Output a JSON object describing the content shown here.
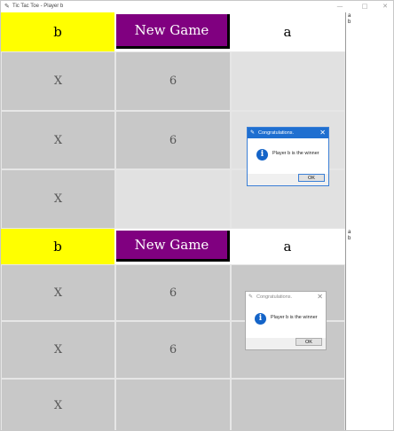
{
  "window": {
    "title": "Tic Tac Toe - Player b",
    "minimize_glyph": "—",
    "maximize_glyph": "□",
    "close_glyph": "✕",
    "app_icon": "feather-icon"
  },
  "colors": {
    "player_b_bg": "#ffff00",
    "player_a_bg": "#ffffff",
    "new_game_bg": "#800080",
    "played_cell": "#c8c8c8",
    "empty_cell": "#e1e1e1",
    "dialog_accent": "#1f6fd0"
  },
  "boards": [
    {
      "header": {
        "left_player": "b",
        "new_game_label": "New Game",
        "right_player": "a"
      },
      "cells": [
        [
          "X",
          "6",
          ""
        ],
        [
          "X",
          "6",
          ""
        ],
        [
          "X",
          "",
          ""
        ]
      ],
      "side_list": [
        "a",
        "b"
      ],
      "dialog": {
        "title": "Congratulations.",
        "message": "Player b is the winner",
        "ok_label": "OK",
        "close_glyph": "✕",
        "icon": "info-icon",
        "icon_glyph": "i",
        "active": true
      }
    },
    {
      "header": {
        "left_player": "b",
        "new_game_label": "New Game",
        "right_player": "a"
      },
      "cells": [
        [
          "X",
          "6",
          ""
        ],
        [
          "X",
          "6",
          ""
        ],
        [
          "X",
          "",
          ""
        ]
      ],
      "side_list": [
        "a",
        "b"
      ],
      "dialog": {
        "title": "Congratulations.",
        "message": "Player b is the winner",
        "ok_label": "OK",
        "close_glyph": "✕",
        "icon": "info-icon",
        "icon_glyph": "i",
        "active": false
      }
    }
  ]
}
